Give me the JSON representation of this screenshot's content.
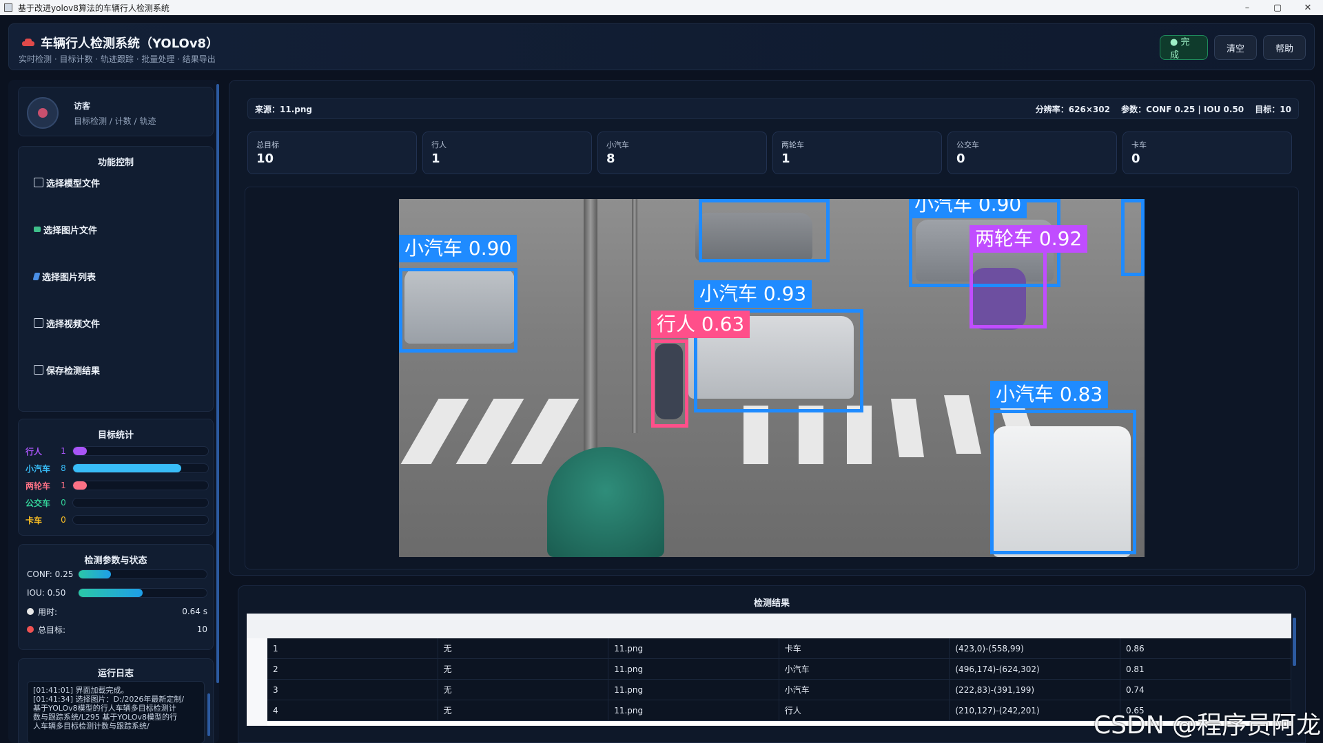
{
  "window": {
    "title": "基于改进yolov8算法的车辆行人检测系统",
    "controls": [
      "–",
      "▢",
      "✕"
    ]
  },
  "header": {
    "title": "车辆行人检测系统（YOLOv8）",
    "subtitle": "实时检测 · 目标计数 · 轨迹跟踪 · 批量处理 · 结果导出",
    "done_label": "● 完成",
    "clear_label": "清空",
    "help_label": "帮助"
  },
  "user": {
    "name": "访客",
    "role": "目标检测 / 计数 / 轨迹"
  },
  "functions": {
    "title": "功能控制",
    "items": [
      {
        "label": "选择模型文件",
        "icon": "model-icon"
      },
      {
        "label": "选择图片文件",
        "icon": "image-icon"
      },
      {
        "label": "选择图片列表",
        "icon": "folder-icon"
      },
      {
        "label": "选择视频文件",
        "icon": "video-icon"
      },
      {
        "label": "保存检测结果",
        "icon": "save-icon"
      }
    ]
  },
  "stats": {
    "title": "目标统计",
    "max": 10,
    "rows": [
      {
        "label": "行人",
        "count": 1,
        "color": "#a855f7"
      },
      {
        "label": "小汽车",
        "count": 8,
        "color": "#38bdf8"
      },
      {
        "label": "两轮车",
        "count": 1,
        "color": "#fb7185"
      },
      {
        "label": "公交车",
        "count": 0,
        "color": "#34d399"
      },
      {
        "label": "卡车",
        "count": 0,
        "color": "#fbbf24"
      }
    ]
  },
  "params": {
    "title": "检测参数与状态",
    "conf_label": "CONF: 0.25",
    "conf_value": 0.25,
    "iou_label": "IOU: 0.50",
    "iou_value": 0.5,
    "time_label": "用时:",
    "time_value": "0.64 s",
    "total_label": "总目标:",
    "total_value": "10"
  },
  "log": {
    "title": "运行日志",
    "lines": [
      "[01:41:01] 界面加载完成。",
      "[01:41:34] 选择图片：D:/2026年最新定制/",
      "基于YOLOv8模型的行人车辆多目标检测计",
      "数与跟踪系统/L295 基于YOLOv8模型的行",
      "人车辆多目标检测计数与跟踪系统/"
    ]
  },
  "info_bar": {
    "source": "来源：11.png",
    "resolution": "分辨率：626×302",
    "params": "参数：CONF 0.25 | IOU 0.50",
    "targets": "目标：10"
  },
  "metrics": [
    {
      "label": "总目标",
      "value": "10"
    },
    {
      "label": "行人",
      "value": "1"
    },
    {
      "label": "小汽车",
      "value": "8"
    },
    {
      "label": "两轮车",
      "value": "1"
    },
    {
      "label": "公交车",
      "value": "0"
    },
    {
      "label": "卡车",
      "value": "0"
    }
  ],
  "detections": [
    {
      "label": "小汽车 0.90",
      "color": "#1f8bff"
    },
    {
      "label": "小汽车 0.90",
      "color": "#1f8bff"
    },
    {
      "label": "两轮车 0.92",
      "color": "#c04dff"
    },
    {
      "label": "小汽车 0.93",
      "color": "#1f8bff"
    },
    {
      "label": "行人 0.63",
      "color": "#ff4f8a"
    },
    {
      "label": "小汽车 0.83",
      "color": "#1f8bff"
    }
  ],
  "results": {
    "title": "检测结果",
    "rows": [
      {
        "idx": "1",
        "track": "无",
        "file": "11.png",
        "cls": "卡车",
        "box": "(423,0)-(558,99)",
        "conf": "0.86"
      },
      {
        "idx": "2",
        "track": "无",
        "file": "11.png",
        "cls": "小汽车",
        "box": "(496,174)-(624,302)",
        "conf": "0.81"
      },
      {
        "idx": "3",
        "track": "无",
        "file": "11.png",
        "cls": "小汽车",
        "box": "(222,83)-(391,199)",
        "conf": "0.74"
      },
      {
        "idx": "4",
        "track": "无",
        "file": "11.png",
        "cls": "行人",
        "box": "(210,127)-(242,201)",
        "conf": "0.65"
      }
    ]
  },
  "watermark": "CSDN @程序员阿龙"
}
